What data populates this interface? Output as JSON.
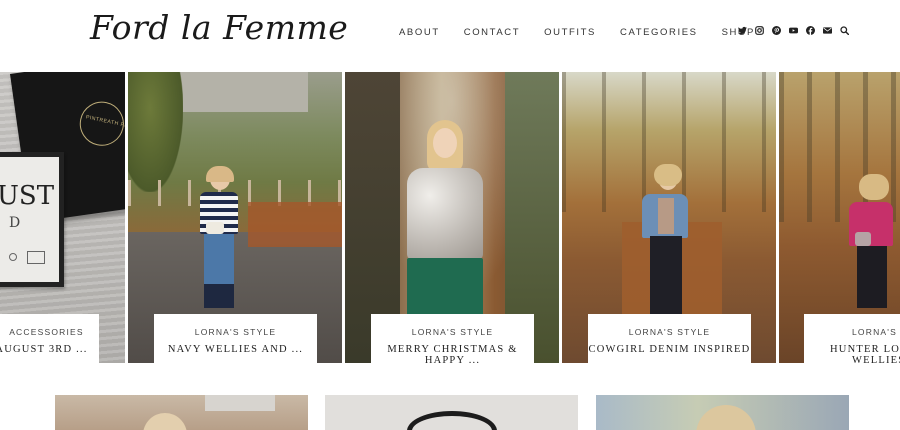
{
  "header": {
    "logo_text": "Ford la Femme",
    "nav": [
      "ABOUT",
      "CONTACT",
      "OUTFITS",
      "CATEGORIES",
      "SHOP"
    ]
  },
  "social_icons": [
    "twitter-icon",
    "instagram-icon",
    "pinterest-icon",
    "youtube-icon",
    "facebook-icon",
    "email-icon",
    "search-icon"
  ],
  "slides": [
    {
      "category": "ACCESSORIES",
      "title": "AUGUST 3RD ..."
    },
    {
      "category": "LORNA'S STYLE",
      "title": "NAVY WELLIES AND ..."
    },
    {
      "category": "LORNA'S STYLE",
      "title_line1": "MERRY CHRISTMAS &",
      "title_line2": "HAPPY ..."
    },
    {
      "category": "LORNA'S STYLE",
      "title": "COWGIRL DENIM INSPIRED"
    },
    {
      "category": "LORNA'S STYLE",
      "title_line1": "HUNTER LOGA",
      "title_line2": "WELLIES"
    }
  ],
  "slide1_image_text": {
    "box_lid": "PINTREATH PENDANT",
    "card_large": "UST",
    "card_small": "D"
  }
}
